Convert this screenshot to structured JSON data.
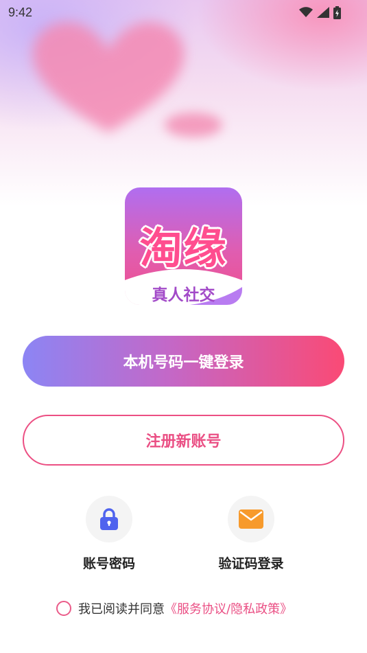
{
  "status_bar": {
    "time": "9:42"
  },
  "logo": {
    "title": "淘缘",
    "subtitle": "真人社交"
  },
  "buttons": {
    "one_click_login": "本机号码一键登录",
    "register": "注册新账号"
  },
  "login_options": [
    {
      "label": "账号密码",
      "icon": "lock-icon"
    },
    {
      "label": "验证码登录",
      "icon": "mail-icon"
    }
  ],
  "agreement": {
    "text": "我已阅读并同意",
    "link": "《服务协议/隐私政策》"
  },
  "colors": {
    "accent_pink": "#ea4f84",
    "gradient_start": "#8c85f4",
    "gradient_end": "#fa4a75",
    "lock_blue": "#4f63ee",
    "mail_orange": "#f79a2c"
  }
}
